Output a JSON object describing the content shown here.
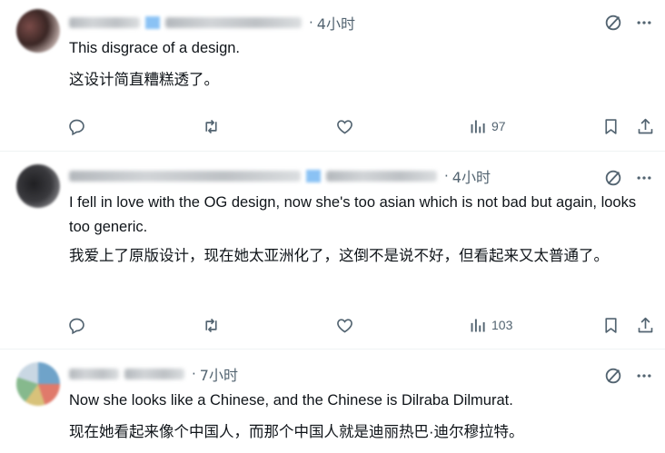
{
  "posts": [
    {
      "time": "4小时",
      "text_en": "This disgrace of a design.",
      "text_zh": "这设计简直糟糕透了。",
      "views": "97"
    },
    {
      "time": "4小时",
      "text_en": "I fell in love with the OG design, now she's too asian which is not bad but again, looks too generic.",
      "text_zh": "我爱上了原版设计，现在她太亚洲化了，这倒不是说不好，但看起来又太普通了。",
      "views": "103"
    },
    {
      "time": "7小时",
      "text_en": "Now she looks like a Chinese, and the Chinese is Dilraba Dilmurat.",
      "text_zh": "现在她看起来像个中国人，而那个中国人就是迪丽热巴·迪尔穆拉特。"
    }
  ],
  "icons": [
    "grok-icon",
    "more-icon",
    "reply-icon",
    "repost-icon",
    "like-icon",
    "views-icon",
    "bookmark-icon",
    "share-icon"
  ],
  "colors": {
    "secondary": "#536471",
    "divider": "#eff3f4"
  }
}
